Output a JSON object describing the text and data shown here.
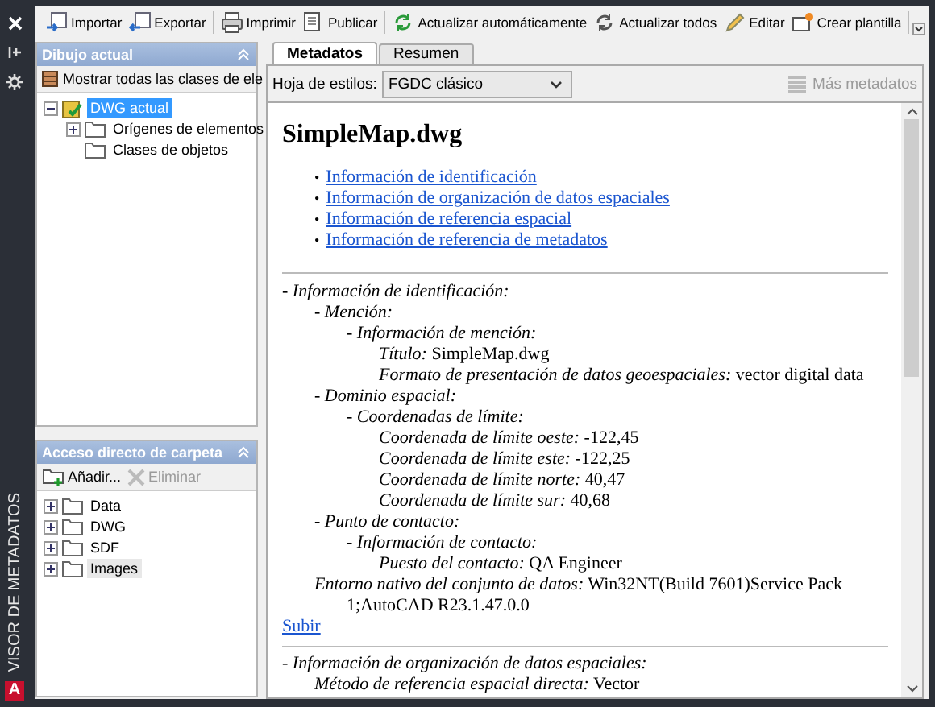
{
  "sidebar_strip": {
    "title": "VISOR DE METADATOS",
    "logo": "A"
  },
  "toolbar": {
    "groups": [
      [
        {
          "label": "Importar"
        },
        {
          "label": "Exportar"
        }
      ],
      [
        {
          "label": "Imprimir"
        },
        {
          "label": "Publicar"
        }
      ],
      [
        {
          "label": "Actualizar automáticamente"
        },
        {
          "label": "Actualizar todos"
        },
        {
          "label": "Editar"
        },
        {
          "label": "Crear plantilla"
        }
      ]
    ]
  },
  "drawing_panel": {
    "title": "Dibujo actual",
    "button": "Mostrar todas las clases de ele",
    "tree": [
      {
        "label": "DWG actual",
        "selected": true,
        "expanded": true,
        "children": [
          {
            "label": "Orígenes de elementos",
            "selected": false,
            "expanded": false
          },
          {
            "label": "Clases de objetos",
            "selected": false
          }
        ]
      }
    ]
  },
  "shortcuts_panel": {
    "title": "Acceso directo de carpeta",
    "buttons": [
      {
        "label": "Añadir...",
        "disabled": false
      },
      {
        "label": "Eliminar",
        "disabled": true
      }
    ],
    "items": [
      {
        "label": "Data",
        "selected": false,
        "expanded": false
      },
      {
        "label": "DWG",
        "selected": false,
        "expanded": false
      },
      {
        "label": "SDF",
        "selected": false,
        "expanded": false
      },
      {
        "label": "Images",
        "selected": true,
        "expanded": false
      }
    ]
  },
  "tabs": [
    {
      "label": "Metadatos",
      "selected": true
    },
    {
      "label": "Resumen",
      "selected": false
    }
  ],
  "stylesheet": {
    "label": "Hoja de estilos:",
    "value": "FGDC clásico"
  },
  "more_button": {
    "label": "Más metadatos",
    "disabled": true
  },
  "document": {
    "title": "SimpleMap.dwg",
    "links": [
      {
        "marker": "•",
        "label": "Información de identificación"
      },
      {
        "marker": "•",
        "label": "Información de organización de datos espaciales"
      },
      {
        "marker": "•",
        "label": "Información de referencia espacial"
      },
      {
        "marker": "•",
        "label": "Información de referencia de metadatos"
      }
    ],
    "sections": [
      {
        "entries": [
          {
            "label": "- Información de identificación:",
            "children": [
              {
                "label": "- Mención:",
                "children": [
                  {
                    "label": "- Información de mención:",
                    "children": [
                      {
                        "label": "Título:",
                        "value": "SimpleMap.dwg"
                      },
                      {
                        "label": "Formato de presentación de datos geoespaciales:",
                        "value": "vector digital data"
                      }
                    ]
                  }
                ]
              },
              {
                "label": "- Dominio espacial:",
                "children": [
                  {
                    "label": "- Coordenadas de límite:",
                    "children": [
                      {
                        "label": "Coordenada de límite oeste:",
                        "value": "-122,45"
                      },
                      {
                        "label": "Coordenada de límite este:",
                        "value": "-122,25"
                      },
                      {
                        "label": "Coordenada de límite norte:",
                        "value": "40,47"
                      },
                      {
                        "label": "Coordenada de límite sur:",
                        "value": "40,68"
                      }
                    ]
                  }
                ]
              },
              {
                "label": "- Punto de contacto:",
                "children": [
                  {
                    "label": "- Información de contacto:",
                    "children": [
                      {
                        "label": "Puesto del contacto:",
                        "value": "QA Engineer"
                      }
                    ]
                  }
                ]
              },
              {
                "label": "Entorno nativo del conjunto de datos:",
                "value": "Win32NT(Build 7601)Service Pack 1;AutoCAD R23.1.47.0.0"
              }
            ]
          }
        ],
        "back_link": "Subir"
      },
      {
        "entries": [
          {
            "label": "- Información de organización de datos espaciales:",
            "children": [
              {
                "label": "Método de referencia espacial directa:",
                "value": "Vector"
              }
            ]
          }
        ]
      }
    ]
  }
}
